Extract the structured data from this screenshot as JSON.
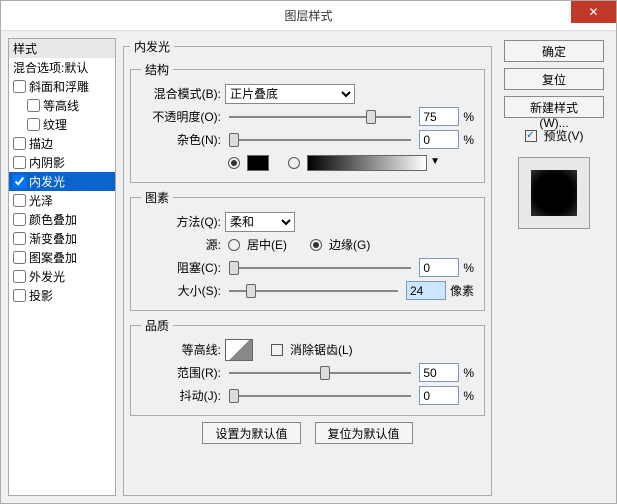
{
  "window": {
    "title": "图层样式",
    "close": "✕"
  },
  "styles": {
    "header": "样式",
    "blendOptions": "混合选项:默认",
    "items": [
      {
        "label": "斜面和浮雕",
        "checked": false,
        "indent": 0
      },
      {
        "label": "等高线",
        "checked": false,
        "indent": 1
      },
      {
        "label": "纹理",
        "checked": false,
        "indent": 1
      },
      {
        "label": "描边",
        "checked": false,
        "indent": 0
      },
      {
        "label": "内阴影",
        "checked": false,
        "indent": 0
      },
      {
        "label": "内发光",
        "checked": true,
        "indent": 0,
        "selected": true
      },
      {
        "label": "光泽",
        "checked": false,
        "indent": 0
      },
      {
        "label": "颜色叠加",
        "checked": false,
        "indent": 0
      },
      {
        "label": "渐变叠加",
        "checked": false,
        "indent": 0
      },
      {
        "label": "图案叠加",
        "checked": false,
        "indent": 0
      },
      {
        "label": "外发光",
        "checked": false,
        "indent": 0
      },
      {
        "label": "投影",
        "checked": false,
        "indent": 0
      }
    ]
  },
  "panel": {
    "title": "内发光",
    "structure": {
      "legend": "结构",
      "blendModeLabel": "混合模式(B):",
      "blendMode": "正片叠底",
      "opacityLabel": "不透明度(O):",
      "opacity": "75",
      "opacityUnit": "%",
      "noiseLabel": "杂色(N):",
      "noise": "0",
      "noiseUnit": "%",
      "color": "#000000"
    },
    "elements": {
      "legend": "图素",
      "techniqueLabel": "方法(Q):",
      "technique": "柔和",
      "sourceLabel": "源:",
      "centerLabel": "居中(E)",
      "edgeLabel": "边缘(G)",
      "chokeLabel": "阻塞(C):",
      "choke": "0",
      "chokeUnit": "%",
      "sizeLabel": "大小(S):",
      "size": "24",
      "sizeUnit": "像素"
    },
    "quality": {
      "legend": "品质",
      "contourLabel": "等高线:",
      "antiAliasLabel": "消除锯齿(L)",
      "rangeLabel": "范围(R):",
      "range": "50",
      "rangeUnit": "%",
      "jitterLabel": "抖动(J):",
      "jitter": "0",
      "jitterUnit": "%"
    },
    "setDefault": "设置为默认值",
    "resetDefault": "复位为默认值"
  },
  "rightPanel": {
    "ok": "确定",
    "cancel": "复位",
    "newStyle": "新建样式(W)...",
    "previewLabel": "预览(V)"
  }
}
